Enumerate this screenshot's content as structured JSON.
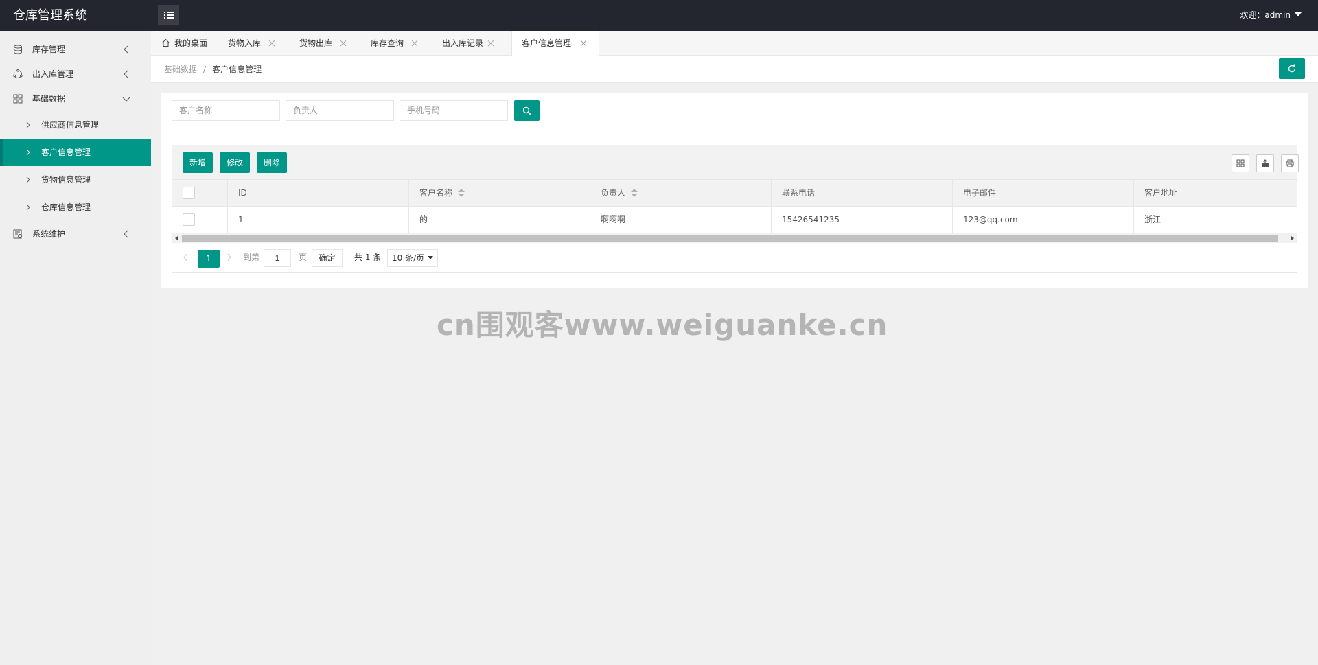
{
  "header": {
    "title": "仓库管理系统",
    "user_text": "欢迎：admin"
  },
  "sidebar": {
    "items": [
      {
        "label": "库存管理",
        "icon": "database-icon"
      },
      {
        "label": "出入库管理",
        "icon": "loop-icon"
      },
      {
        "label": "基础数据",
        "icon": "grid-icon"
      },
      {
        "label": "系统维护",
        "icon": "settings-box-icon"
      }
    ],
    "sub_items": [
      {
        "label": "供应商信息管理"
      },
      {
        "label": "客户信息管理"
      },
      {
        "label": "货物信息管理"
      },
      {
        "label": "仓库信息管理"
      }
    ]
  },
  "tabs": [
    {
      "label": "我的桌面"
    },
    {
      "label": "货物入库"
    },
    {
      "label": "货物出库"
    },
    {
      "label": "库存查询"
    },
    {
      "label": "出入库记录"
    },
    {
      "label": "客户信息管理"
    }
  ],
  "breadcrumb": {
    "parent": "基础数据",
    "separator": "/",
    "current": "客户信息管理"
  },
  "search": {
    "name_placeholder": "客户名称",
    "contact_placeholder": "负责人",
    "phone_placeholder": "手机号码"
  },
  "toolbar": {
    "add_label": "新增",
    "edit_label": "修改",
    "delete_label": "删除"
  },
  "table": {
    "columns": [
      "ID",
      "客户名称",
      "负责人",
      "联系电话",
      "电子邮件",
      "客户地址"
    ],
    "rows": [
      [
        "1",
        "的",
        "啊啊啊",
        "15426541235",
        "123@qq.com",
        "浙江"
      ]
    ]
  },
  "pager": {
    "current_page": "1",
    "goto_label": "到第",
    "goto_value": "1",
    "page_label": "页",
    "ok_label": "确定",
    "total_label": "共 1 条",
    "page_size": "10 条/页"
  },
  "watermark": "cn围观客www.weiguanke.cn",
  "colors": {
    "accent": "#009688",
    "header_bg": "#23262e"
  }
}
